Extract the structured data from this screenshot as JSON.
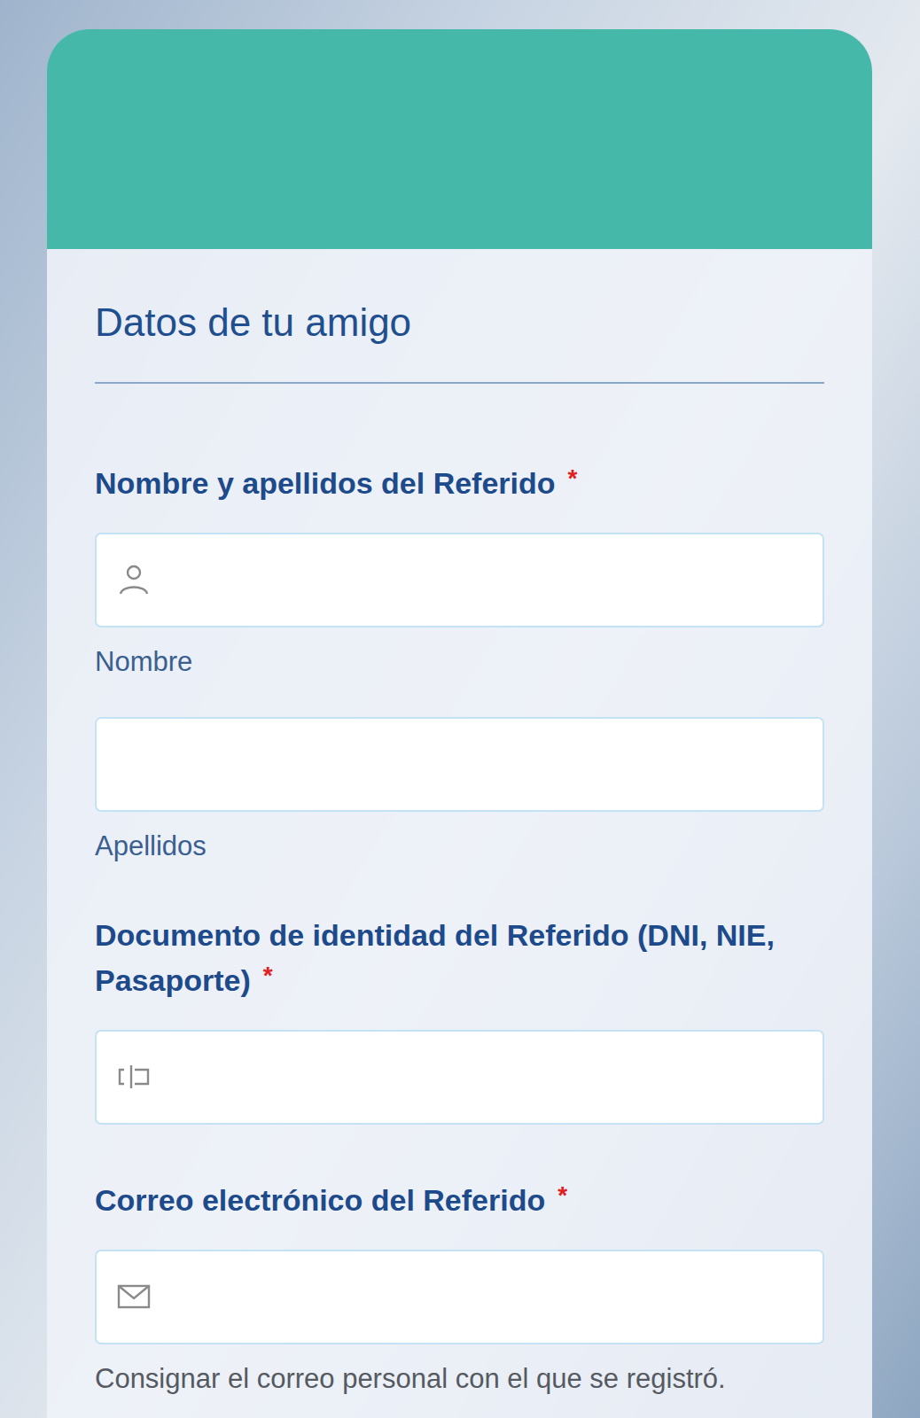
{
  "form": {
    "section_title": "Datos de tu amigo",
    "fields": [
      {
        "label": "Nombre y apellidos del Referido",
        "required": true,
        "required_mark": "*",
        "inputs": [
          {
            "kind": "name",
            "value": "",
            "hint": "Nombre"
          },
          {
            "kind": "surname",
            "value": "",
            "hint": "Apellidos"
          }
        ]
      },
      {
        "label": "Documento de identidad del Referido (DNI, NIE, Pasaporte)",
        "required": true,
        "required_mark": "*",
        "inputs": [
          {
            "kind": "document",
            "value": "",
            "hint": ""
          }
        ]
      },
      {
        "label": "Correo electrónico del Referido",
        "required": true,
        "required_mark": "*",
        "inputs": [
          {
            "kind": "email",
            "value": "",
            "hint": "Consignar el correo personal con el que se registró."
          }
        ]
      }
    ]
  }
}
